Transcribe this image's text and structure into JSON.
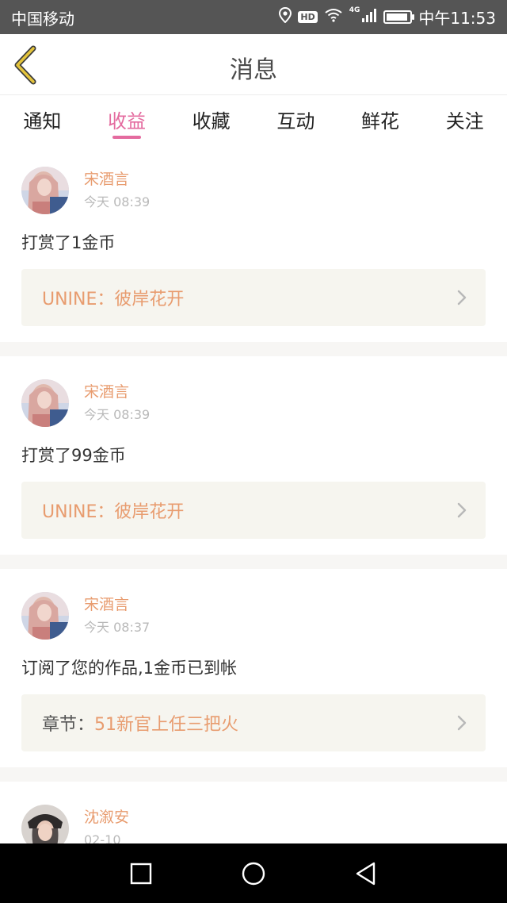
{
  "status_bar": {
    "carrier": "中国移动",
    "network": "4G",
    "hd": "HD",
    "time": "中午11:53",
    "battery_level": 0.9
  },
  "header": {
    "title": "消息",
    "back_icon": "back-chevron-icon",
    "accent_color": "#e4c43c"
  },
  "tabs": [
    {
      "label": "通知",
      "active": false
    },
    {
      "label": "收益",
      "active": true
    },
    {
      "label": "收藏",
      "active": false
    },
    {
      "label": "互动",
      "active": false
    },
    {
      "label": "鲜花",
      "active": false
    },
    {
      "label": "关注",
      "active": false
    }
  ],
  "feed": [
    {
      "user": "宋酒言",
      "time": "今天 08:39",
      "text": "打赏了1金币",
      "ref_prefix": "UNINE：",
      "ref_title": "彼岸花开"
    },
    {
      "user": "宋酒言",
      "time": "今天 08:39",
      "text": "打赏了99金币",
      "ref_prefix": "UNINE：",
      "ref_title": "彼岸花开"
    },
    {
      "user": "宋酒言",
      "time": "今天 08:37",
      "text": "订阅了您的作品,1金币已到帐",
      "ref_prefix": "章节：",
      "ref_title": "51新官上任三把火"
    },
    {
      "user": "沈溆安",
      "time": "02-10",
      "text": "",
      "ref_prefix": "",
      "ref_title": ""
    }
  ],
  "colors": {
    "tab_active": "#e46b9f",
    "name": "#e89c6f",
    "ref_bg": "#f6f5ef"
  },
  "nav": {
    "recent_icon": "square-icon",
    "home_icon": "circle-icon",
    "back_icon": "triangle-back-icon"
  }
}
